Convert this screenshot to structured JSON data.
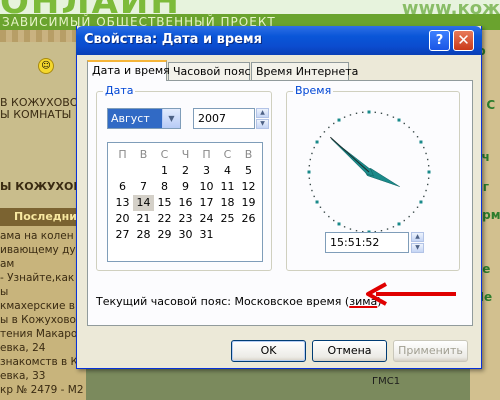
{
  "background": {
    "logo": "ОНЛАЙН",
    "tagline": "ЗАВИСИМЫЙ ОБЩЕСТВЕННЫЙ ПРОЕКТ",
    "url_fragment": "www.кож",
    "side_lines": [
      "В КОЖУХОВО:",
      "Ы КОМНАТЫ",
      "Ы КОЖУХОВО"
    ],
    "list_header": "Последни",
    "list_items": [
      "ама на колен",
      "ивающему дух",
      "ам",
      "- Узнайте,как",
      "ы",
      "кмахерские в",
      "ы в Кожухово",
      "тения Макаров",
      "евка, 24",
      "знакомств в К",
      "евка, 33",
      "кр № 2479 - М2"
    ],
    "right_labels": [
      "ю",
      "З",
      "к С",
      "вч",
      "Сг",
      "ерм",
      "ое",
      "Пе"
    ],
    "map_label": "ГМС1",
    "smiley": "☺"
  },
  "dialog": {
    "title": "Свойства: Дата и время",
    "help_label": "?",
    "close_label": "✕",
    "tabs": [
      "Дата и время",
      "Часовой пояс",
      "Время Интернета"
    ],
    "date_group": {
      "label": "Дата",
      "month": "Август",
      "year": "2007",
      "weekdays": [
        "П",
        "В",
        "С",
        "Ч",
        "П",
        "С",
        "В"
      ],
      "days": [
        "",
        "",
        "1",
        "2",
        "3",
        "4",
        "5",
        "6",
        "7",
        "8",
        "9",
        "10",
        "11",
        "12",
        "13",
        "14",
        "15",
        "16",
        "17",
        "18",
        "19",
        "20",
        "21",
        "22",
        "23",
        "24",
        "25",
        "26",
        "27",
        "28",
        "29",
        "30",
        "31",
        "",
        ""
      ],
      "selected_day": "14"
    },
    "time_group": {
      "label": "Время",
      "time": "15:51:52"
    },
    "timezone_prefix": "Текущий часовой пояс: Московское время (",
    "timezone_highlight": "зима",
    "timezone_suffix": ")",
    "buttons": {
      "ok": "OK",
      "cancel": "Отмена",
      "apply": "Применить"
    },
    "colors": {
      "clock_hand": "#1a8a8a",
      "annotation_arrow": "#e00000",
      "accent_tab": "#f5b53a"
    }
  }
}
